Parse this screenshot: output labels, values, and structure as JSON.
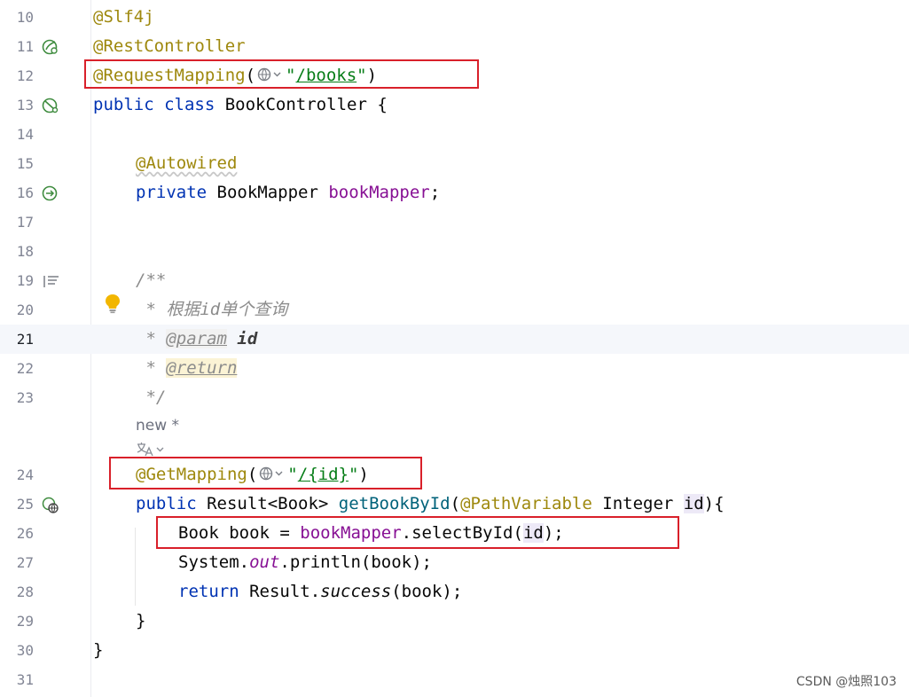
{
  "editor": {
    "lines": [
      {
        "num": "10"
      },
      {
        "num": "11"
      },
      {
        "num": "12"
      },
      {
        "num": "13"
      },
      {
        "num": "14"
      },
      {
        "num": "15"
      },
      {
        "num": "16"
      },
      {
        "num": "17"
      },
      {
        "num": "18"
      },
      {
        "num": "19"
      },
      {
        "num": "20"
      },
      {
        "num": "21"
      },
      {
        "num": "22"
      },
      {
        "num": "23"
      },
      {
        "num": "24"
      },
      {
        "num": "25"
      },
      {
        "num": "26"
      },
      {
        "num": "27"
      },
      {
        "num": "28"
      },
      {
        "num": "29"
      },
      {
        "num": "30"
      },
      {
        "num": "31"
      }
    ],
    "current_line": "21",
    "code": {
      "slf4j": "@Slf4j",
      "rest_controller": "@RestController",
      "request_mapping": "@RequestMapping",
      "open_paren": "(",
      "close_paren": ")",
      "quote": "\"",
      "books_path": "/books",
      "public": "public",
      "class": "class",
      "class_name": " BookController {",
      "autowired": "@Autowired",
      "private": "private",
      "mapper_type": " BookMapper ",
      "mapper_field": "bookMapper",
      "semicolon": ";",
      "doc_open": "/**",
      "doc_desc_star": " * ",
      "doc_desc": "根据id单个查询",
      "doc_param_tag": "@param",
      "doc_param_val": "id",
      "doc_return_tag": "@return",
      "doc_close": " */",
      "get_mapping": "@GetMapping",
      "id_path": "/{id}",
      "result_sig": " Result<Book> ",
      "method_name": "getBookById",
      "path_variable": "@PathVariable",
      "integer": " Integer ",
      "id": "id",
      "sig_end": "){",
      "book_decl": "Book book = ",
      "select_call": ".selectById(",
      "select_end": ");",
      "system": "System.",
      "out": "out",
      "println": ".println(book);",
      "return": "return",
      "result_dot": " Result.",
      "success": "success",
      "success_args": "(book);",
      "brace_close": "}"
    },
    "inlay_hint": "new *"
  },
  "watermark": "CSDN @烛照103",
  "colors": {
    "annotation": "#9e880d",
    "keyword": "#0033b3",
    "string": "#067d17",
    "field": "#871094",
    "method": "#00627a",
    "highlight_box": "#d9202a"
  }
}
